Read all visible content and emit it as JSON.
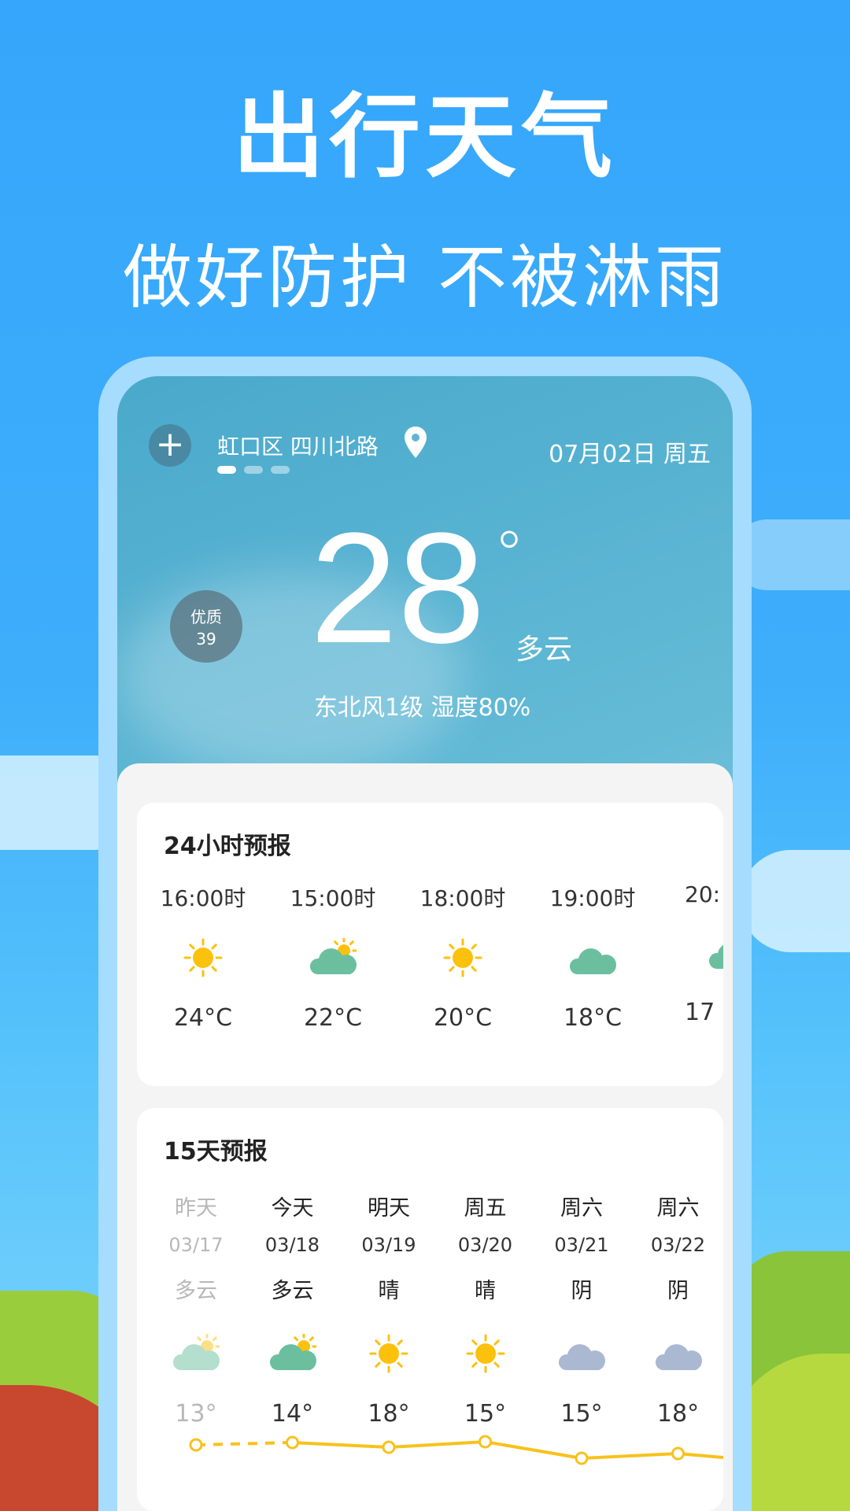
{
  "headline": "出行天气",
  "subheadline": "做好防护  不被淋雨",
  "header": {
    "location": "虹口区 四川北路",
    "date": "07月02日 周五",
    "page_dots": 3,
    "active_dot": 0
  },
  "current": {
    "aqi_label": "优质",
    "aqi_value": "39",
    "temperature": "28",
    "degree": "°",
    "condition": "多云",
    "wind_humidity": "东北风1级  湿度80%"
  },
  "hourly": {
    "title": "24小时预报",
    "items": [
      {
        "time": "16:00时",
        "icon": "sun",
        "temp": "24°C"
      },
      {
        "time": "15:00时",
        "icon": "cloud-sun",
        "temp": "22°C"
      },
      {
        "time": "18:00时",
        "icon": "sun",
        "temp": "20°C"
      },
      {
        "time": "19:00时",
        "icon": "cloud",
        "temp": "18°C"
      },
      {
        "time": "20:",
        "icon": "cloud",
        "temp": "17"
      }
    ]
  },
  "daily": {
    "title": "15天预报",
    "items": [
      {
        "day": "昨天",
        "date": "03/17",
        "cond": "多云",
        "icon": "cloud-sun",
        "temp": "13°",
        "past": true
      },
      {
        "day": "今天",
        "date": "03/18",
        "cond": "多云",
        "icon": "cloud-sun",
        "temp": "14°"
      },
      {
        "day": "明天",
        "date": "03/19",
        "cond": "晴",
        "icon": "sun",
        "temp": "18°"
      },
      {
        "day": "周五",
        "date": "03/20",
        "cond": "晴",
        "icon": "sun",
        "temp": "15°"
      },
      {
        "day": "周六",
        "date": "03/21",
        "cond": "阴",
        "icon": "overcast",
        "temp": "15°"
      },
      {
        "day": "周六",
        "date": "03/22",
        "cond": "阴",
        "icon": "overcast",
        "temp": "18°"
      }
    ]
  },
  "colors": {
    "background": "#35a6fb",
    "sun": "#fcc10d",
    "cloud_green": "#6bbf9f",
    "overcast": "#aab9d1",
    "line": "#f7c21b"
  }
}
